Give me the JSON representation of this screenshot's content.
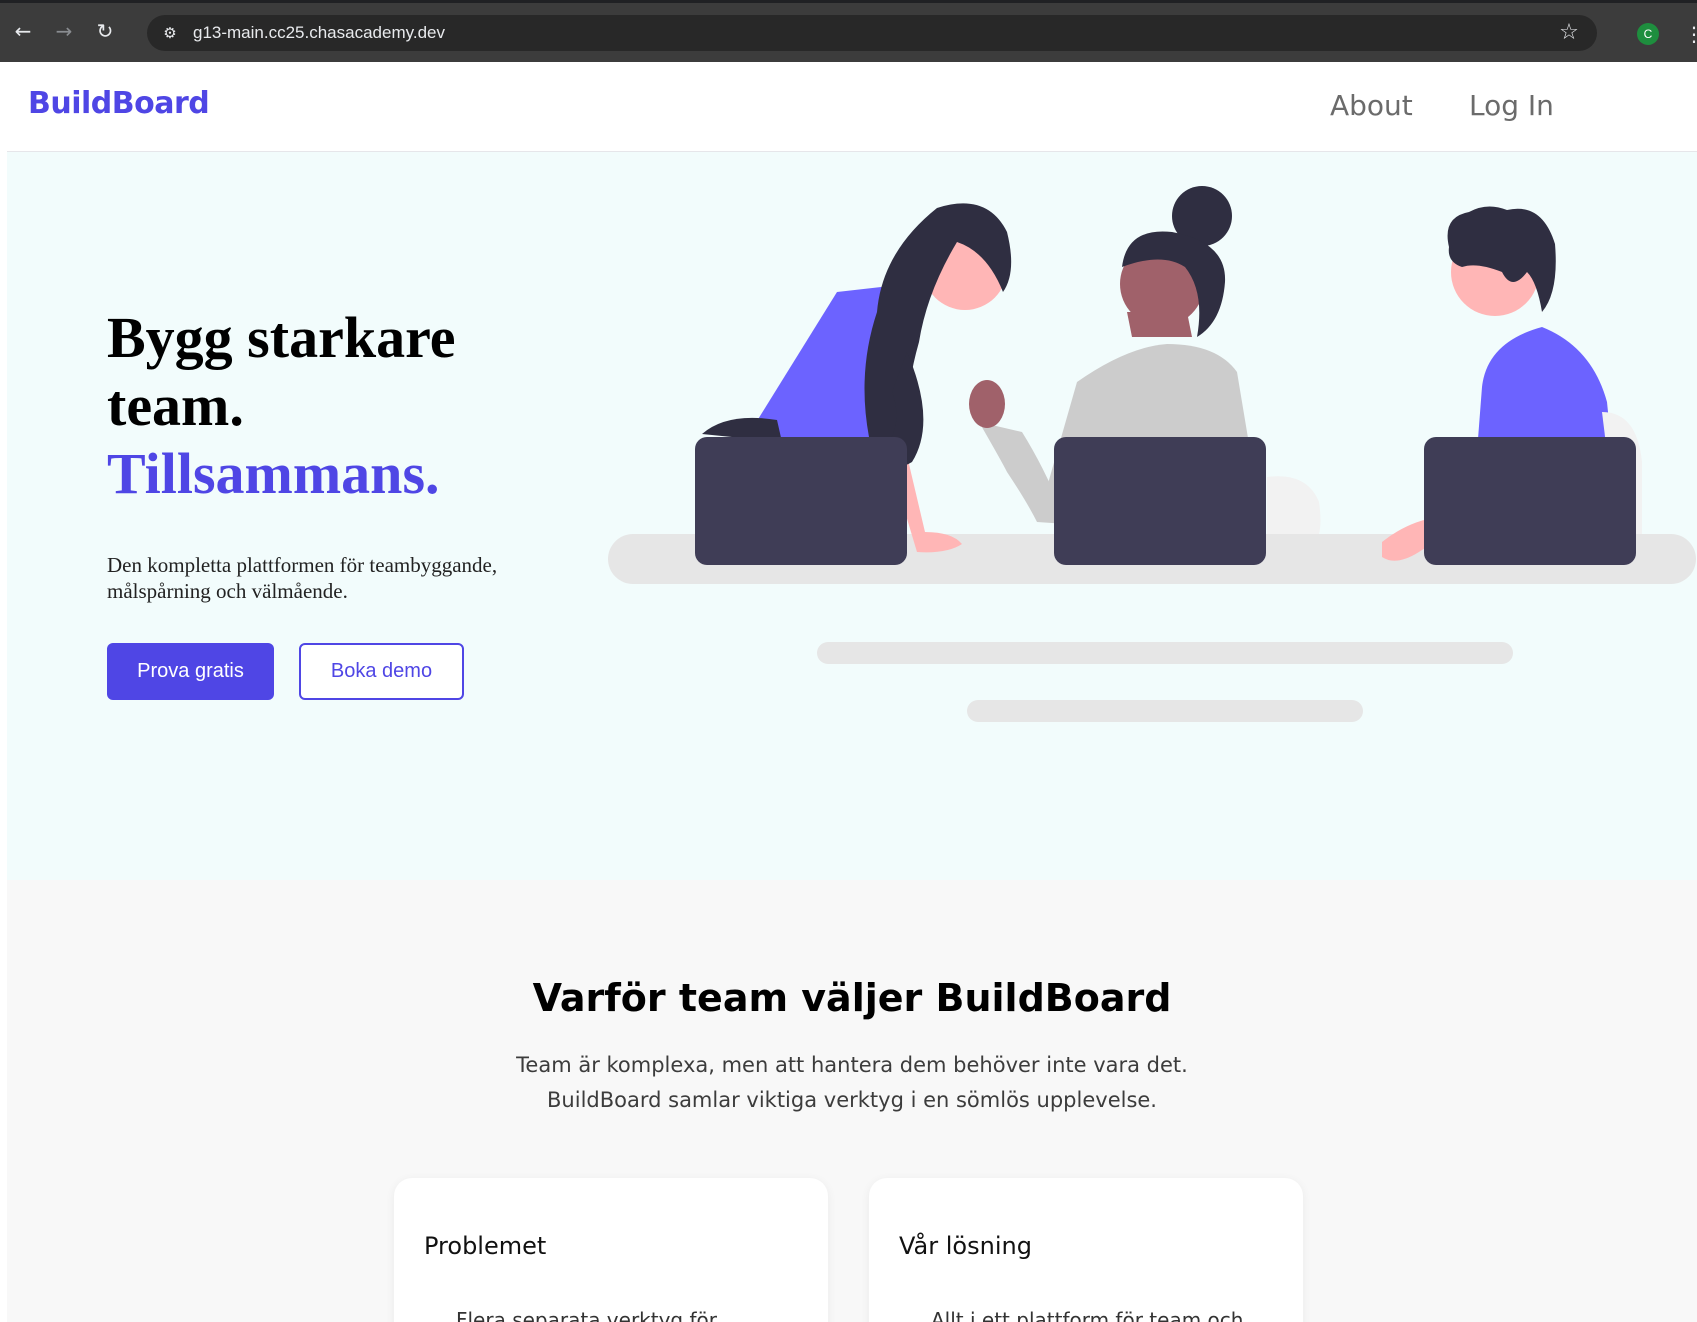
{
  "browser": {
    "back_icon": "arrow-left-icon",
    "forward_icon": "arrow-right-icon",
    "reload_icon": "reload-icon",
    "url": "g13-main.cc25.chasacademy.dev",
    "profile_initial": "C",
    "colors": {
      "chrome": "#3c3c3c",
      "url_box": "#282828",
      "profile": "#1e8e3e"
    }
  },
  "header": {
    "brand": "BuildBoard",
    "nav": [
      {
        "label": "About"
      },
      {
        "label": "Log In"
      }
    ]
  },
  "hero": {
    "title_line1": "Bygg starkare",
    "title_line2": "team.",
    "title_accent": "Tillsammans.",
    "subtitle": "Den kompletta plattformen för teambyggande, målspårning och välmående.",
    "primary_button": "Prova gratis",
    "secondary_button": "Boka demo",
    "illustration": "team-at-laptops-illustration"
  },
  "features": {
    "title": "Varför team väljer BuildBoard",
    "subtitle": "Team är komplexa, men att hantera dem behöver inte vara det. BuildBoard samlar viktiga verktyg i en sömlös upplevelse.",
    "cards": [
      {
        "title": "Problemet",
        "first_item": "Flera separata verktyg för"
      },
      {
        "title": "Vår lösning",
        "first_item": "Allt i ett plattform för team och"
      }
    ]
  },
  "colors": {
    "accent": "#4f46e5",
    "hero_bg": "#f2fcfc",
    "features_bg": "#f8f8f8",
    "illustration_purple": "#6c63ff",
    "laptop": "#3f3d56"
  }
}
